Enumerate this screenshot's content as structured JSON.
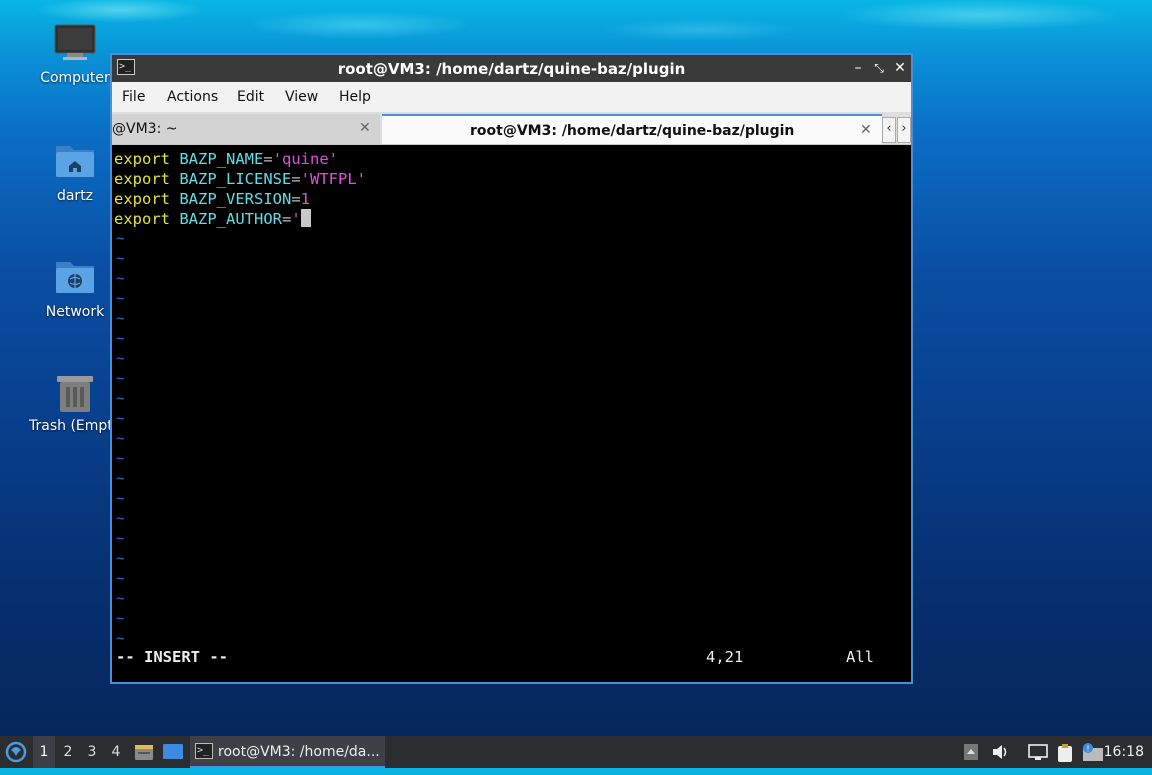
{
  "desktop": {
    "icons": [
      {
        "label": "Computer"
      },
      {
        "label": "dartz"
      },
      {
        "label": "Network"
      },
      {
        "label": "Trash (Empty)"
      }
    ]
  },
  "window": {
    "title": "root@VM3: /home/dartz/quine-baz/plugin",
    "menu": [
      "File",
      "Actions",
      "Edit",
      "View",
      "Help"
    ],
    "tabs": [
      {
        "label": "@VM3: ~",
        "active": false
      },
      {
        "label": "root@VM3: /home/dartz/quine-baz/plugin",
        "active": true
      }
    ]
  },
  "editor": {
    "lines": [
      {
        "kw": "export",
        "var": "BAZP_NAME",
        "eq": "=",
        "val": "'quine'"
      },
      {
        "kw": "export",
        "var": "BAZP_LICENSE",
        "eq": "=",
        "val": "'WTFPL'"
      },
      {
        "kw": "export",
        "var": "BAZP_VERSION",
        "eq": "=",
        "val": "1"
      },
      {
        "kw": "export",
        "var": "BAZP_AUTHOR",
        "eq": "=",
        "val": "'"
      }
    ],
    "tilde": "~",
    "mode": "-- INSERT --",
    "position": "4,21",
    "scroll": "All"
  },
  "taskbar": {
    "workspaces": [
      "1",
      "2",
      "3",
      "4"
    ],
    "active_workspace": "1",
    "task_label": "root@VM3: /home/da...",
    "clock": "16:18"
  },
  "colors": {
    "accent": "#4a8fd8",
    "keyword": "#e8e33a",
    "variable": "#5fdfe8",
    "string": "#e04fe0",
    "tilde": "#3a64d8"
  }
}
